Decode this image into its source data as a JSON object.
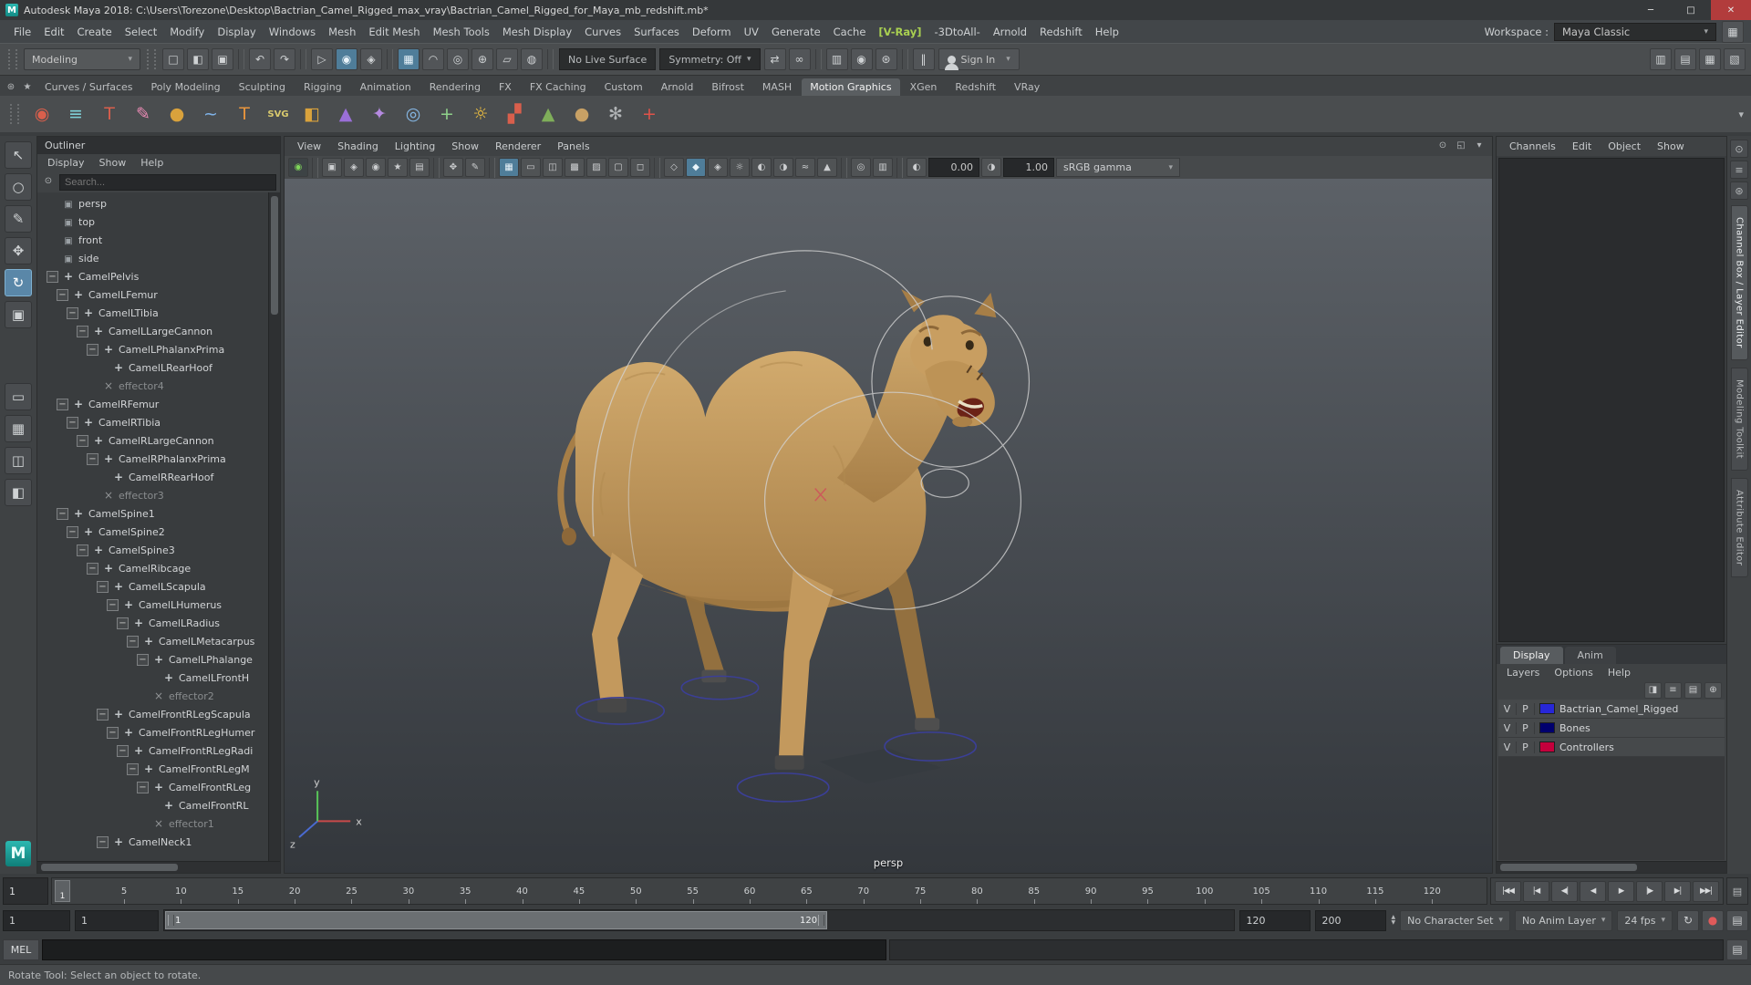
{
  "titlebar": {
    "app_initial": "M",
    "title": "Autodesk Maya 2018: C:\\Users\\Torezone\\Desktop\\Bactrian_Camel_Rigged_max_vray\\Bactrian_Camel_Rigged_for_Maya_mb_redshift.mb*",
    "buttons": {
      "minimize": "─",
      "maximize": "□",
      "close": "✕"
    }
  },
  "menubar": {
    "items": [
      {
        "label": "File"
      },
      {
        "label": "Edit"
      },
      {
        "label": "Create"
      },
      {
        "label": "Select"
      },
      {
        "label": "Modify"
      },
      {
        "label": "Display"
      },
      {
        "label": "Windows"
      },
      {
        "label": "Mesh"
      },
      {
        "label": "Edit Mesh"
      },
      {
        "label": "Mesh Tools"
      },
      {
        "label": "Mesh Display"
      },
      {
        "label": "Curves"
      },
      {
        "label": "Surfaces"
      },
      {
        "label": "Deform"
      },
      {
        "label": "UV"
      },
      {
        "label": "Generate"
      },
      {
        "label": "Cache"
      },
      {
        "label": "[V-Ray]",
        "cls": "vray"
      },
      {
        "label": "-3DtoAll-"
      },
      {
        "label": "Arnold"
      },
      {
        "label": "Redshift"
      },
      {
        "label": "Help"
      }
    ],
    "workspace_label": "Workspace :",
    "workspace_value": "Maya Classic"
  },
  "statusline": {
    "menuset": "Modeling",
    "icons1": [
      {
        "name": "new-scene-icon",
        "g": "□"
      },
      {
        "name": "open-scene-icon",
        "g": "◧"
      },
      {
        "name": "save-scene-icon",
        "g": "▣"
      },
      {
        "name": "separator",
        "cls": "sep",
        "g": ""
      },
      {
        "name": "undo-icon",
        "g": "↶"
      },
      {
        "name": "redo-icon",
        "g": "↷"
      },
      {
        "name": "separator",
        "cls": "sep",
        "g": ""
      },
      {
        "name": "select-hierarchy-icon",
        "g": "▷"
      },
      {
        "name": "select-object-icon",
        "g": "◉",
        "cls": "on"
      },
      {
        "name": "select-component-icon",
        "g": "◈"
      },
      {
        "name": "separator",
        "cls": "sep",
        "g": ""
      },
      {
        "name": "snap-to-grid-icon",
        "g": "▦",
        "cls": "on"
      },
      {
        "name": "snap-to-curve-icon",
        "g": "◠"
      },
      {
        "name": "snap-to-point-icon",
        "g": "◎"
      },
      {
        "name": "snap-to-projected-center-icon",
        "g": "⊕"
      },
      {
        "name": "snap-to-view-plane-icon",
        "g": "▱"
      },
      {
        "name": "make-object-live-icon",
        "g": "◍"
      },
      {
        "name": "separator",
        "cls": "sep",
        "g": ""
      }
    ],
    "live_surface": "No Live Surface",
    "symmetry": "Symmetry: Off",
    "icons2": [
      {
        "name": "input-connections-icon",
        "g": "⇄"
      },
      {
        "name": "construction-history-icon",
        "g": "∞"
      },
      {
        "name": "separator",
        "cls": "sep",
        "g": ""
      },
      {
        "name": "render-frame-icon",
        "g": "▥"
      },
      {
        "name": "ipr-render-icon",
        "g": "◉"
      },
      {
        "name": "render-settings-icon",
        "g": "⊛"
      },
      {
        "name": "separator",
        "cls": "sep",
        "g": ""
      },
      {
        "name": "pause-viewport-icon",
        "g": "‖"
      }
    ],
    "signin_label": "Sign In",
    "right_icons": [
      {
        "name": "sidebar-channel-box-toggle-icon",
        "g": "▥"
      },
      {
        "name": "sidebar-attribute-editor-toggle-icon",
        "g": "▤"
      },
      {
        "name": "sidebar-tool-settings-toggle-icon",
        "g": "▦"
      },
      {
        "name": "sidebar-outliner-toggle-icon",
        "g": "▧"
      }
    ]
  },
  "shelf": {
    "corner_icons": [
      {
        "name": "shelf-options-icon",
        "g": "⊛"
      },
      {
        "name": "shelf-bookmark-icon",
        "g": "★"
      }
    ],
    "tabs": [
      {
        "label": "Curves / Surfaces"
      },
      {
        "label": "Poly Modeling"
      },
      {
        "label": "Sculpting"
      },
      {
        "label": "Rigging"
      },
      {
        "label": "Animation"
      },
      {
        "label": "Rendering"
      },
      {
        "label": "FX"
      },
      {
        "label": "FX Caching"
      },
      {
        "label": "Custom"
      },
      {
        "label": "Arnold"
      },
      {
        "label": "Bifrost"
      },
      {
        "label": "MASH"
      },
      {
        "label": "Motion Graphics",
        "cls": "active"
      },
      {
        "label": "XGen"
      },
      {
        "label": "Redshift"
      },
      {
        "label": "VRay"
      }
    ],
    "items": [
      {
        "name": "mash-network-icon",
        "g": "◉",
        "c": "#d95f4c"
      },
      {
        "name": "mash-editor-icon",
        "g": "≡",
        "c": "#7fd1d8"
      },
      {
        "name": "type-tool-icon",
        "g": "T",
        "c": "#d95f4c"
      },
      {
        "name": "paint-effects-icon",
        "g": "✎",
        "c": "#e98ab4"
      },
      {
        "name": "poly-sphere-icon",
        "g": "●",
        "c": "#d9a23c"
      },
      {
        "name": "curve-tool-icon",
        "g": "~",
        "c": "#7fb2e8"
      },
      {
        "name": "three-d-type-icon",
        "g": "T",
        "c": "#e8953d"
      },
      {
        "name": "svg-tool-icon",
        "g": "SVG",
        "c": "#d8c96d",
        "cls": "small"
      },
      {
        "name": "poly-cube-icon",
        "g": "◧",
        "c": "#d9a23c"
      },
      {
        "name": "fluids-icon",
        "g": "▲",
        "c": "#9a6fd8"
      },
      {
        "name": "nparticle-icon",
        "g": "✦",
        "c": "#b58ae0"
      },
      {
        "name": "optical-fx-icon",
        "g": "◎",
        "c": "#86b8e6"
      },
      {
        "name": "motion-path-icon",
        "g": "+",
        "c": "#8fd18a"
      },
      {
        "name": "sun-light-icon",
        "g": "☼",
        "c": "#f0c040"
      },
      {
        "name": "crowd-sim-icon",
        "g": "▞",
        "c": "#d95f4c"
      },
      {
        "name": "arrow-field-icon",
        "g": "▲",
        "c": "#7fae5a"
      },
      {
        "name": "sand-sphere-icon",
        "g": "●",
        "c": "#c8a165"
      },
      {
        "name": "gear-flower-icon",
        "g": "✻",
        "c": "#b0b3b5"
      },
      {
        "name": "add-attribute-icon",
        "g": "+",
        "c": "#e0524a"
      }
    ],
    "more_glyph": "▾"
  },
  "toolbox": {
    "tools": [
      {
        "name": "select-tool",
        "g": "↖"
      },
      {
        "name": "lasso-select-tool",
        "g": "○"
      },
      {
        "name": "paint-selection-tool",
        "g": "✎"
      },
      {
        "name": "move-tool",
        "g": "✥"
      },
      {
        "name": "rotate-tool",
        "g": "↻",
        "cls": "active"
      },
      {
        "name": "scale-tool",
        "g": "▣"
      }
    ],
    "layouts": [
      {
        "name": "layout-single-pane",
        "g": "▭"
      },
      {
        "name": "layout-four-pane",
        "g": "▦"
      },
      {
        "name": "layout-two-pane",
        "g": "◫"
      },
      {
        "name": "layout-persp-outliner",
        "g": "◧"
      }
    ],
    "logo": "M"
  },
  "outliner": {
    "title": "Outliner",
    "menus": [
      "Display",
      "Show",
      "Help"
    ],
    "search_placeholder": "Search...",
    "tree": [
      {
        "label": "persp",
        "ind": 0,
        "icon": "cam"
      },
      {
        "label": "top",
        "ind": 0,
        "icon": "cam"
      },
      {
        "label": "front",
        "ind": 0,
        "icon": "cam"
      },
      {
        "label": "side",
        "ind": 0,
        "icon": "cam"
      },
      {
        "label": "CamelPelvis",
        "ind": 0,
        "icon": "joint",
        "exp": "−"
      },
      {
        "label": "CamelLFemur",
        "ind": 1,
        "icon": "joint",
        "exp": "−"
      },
      {
        "label": "CamelLTibia",
        "ind": 2,
        "icon": "joint",
        "exp": "−"
      },
      {
        "label": "CamelLLargeCannon",
        "ind": 3,
        "icon": "joint",
        "exp": "−"
      },
      {
        "label": "CamelLPhalanxPrima",
        "ind": 4,
        "icon": "joint",
        "exp": "−"
      },
      {
        "label": "CamelLRearHoof",
        "ind": 5,
        "icon": "joint"
      },
      {
        "label": "effector4",
        "ind": 4,
        "icon": "eff",
        "cls": "dim"
      },
      {
        "label": "CamelRFemur",
        "ind": 1,
        "icon": "joint",
        "exp": "−"
      },
      {
        "label": "CamelRTibia",
        "ind": 2,
        "icon": "joint",
        "exp": "−"
      },
      {
        "label": "CamelRLargeCannon",
        "ind": 3,
        "icon": "joint",
        "exp": "−"
      },
      {
        "label": "CamelRPhalanxPrima",
        "ind": 4,
        "icon": "joint",
        "exp": "−"
      },
      {
        "label": "CamelRRearHoof",
        "ind": 5,
        "icon": "joint"
      },
      {
        "label": "effector3",
        "ind": 4,
        "icon": "eff",
        "cls": "dim"
      },
      {
        "label": "CamelSpine1",
        "ind": 1,
        "icon": "joint",
        "exp": "−"
      },
      {
        "label": "CamelSpine2",
        "ind": 2,
        "icon": "joint",
        "exp": "−"
      },
      {
        "label": "CamelSpine3",
        "ind": 3,
        "icon": "joint",
        "exp": "−"
      },
      {
        "label": "CamelRibcage",
        "ind": 4,
        "icon": "joint",
        "exp": "−"
      },
      {
        "label": "CamelLScapula",
        "ind": 5,
        "icon": "joint",
        "exp": "−"
      },
      {
        "label": "CamelLHumerus",
        "ind": 6,
        "icon": "joint",
        "exp": "−"
      },
      {
        "label": "CamelLRadius",
        "ind": 7,
        "icon": "joint",
        "exp": "−"
      },
      {
        "label": "CamelLMetacarpus",
        "ind": 8,
        "icon": "joint",
        "exp": "−"
      },
      {
        "label": "CamelLPhalange",
        "ind": 9,
        "icon": "joint",
        "exp": "−"
      },
      {
        "label": "CamelLFrontH",
        "ind": 10,
        "icon": "joint"
      },
      {
        "label": "effector2",
        "ind": 9,
        "icon": "eff",
        "cls": "dim"
      },
      {
        "label": "CamelFrontRLegScapula",
        "ind": 5,
        "icon": "joint",
        "exp": "−"
      },
      {
        "label": "CamelFrontRLegHumer",
        "ind": 6,
        "icon": "joint",
        "exp": "−"
      },
      {
        "label": "CamelFrontRLegRadi",
        "ind": 7,
        "icon": "joint",
        "exp": "−"
      },
      {
        "label": "CamelFrontRLegM",
        "ind": 8,
        "icon": "joint",
        "exp": "−"
      },
      {
        "label": "CamelFrontRLeg",
        "ind": 9,
        "icon": "joint",
        "exp": "−"
      },
      {
        "label": "CamelFrontRL",
        "ind": 10,
        "icon": "joint"
      },
      {
        "label": "effector1",
        "ind": 9,
        "icon": "eff",
        "cls": "dim"
      },
      {
        "label": "CamelNeck1",
        "ind": 5,
        "icon": "joint",
        "exp": "−"
      }
    ]
  },
  "viewport": {
    "menus": [
      "View",
      "Shading",
      "Lighting",
      "Show",
      "Renderer",
      "Panels"
    ],
    "panel_icons": [
      {
        "name": "panel-pin-icon",
        "g": "⊙"
      },
      {
        "name": "panel-tearoff-icon",
        "g": "◱"
      },
      {
        "name": "panel-menu-icon",
        "g": "▾"
      }
    ],
    "toolbar_icons": [
      {
        "name": "viewport-renderer-status-icon",
        "g": "◉",
        "cls": "green"
      },
      {
        "name": "separator",
        "cls": "sep",
        "g": ""
      },
      {
        "name": "select-camera-icon",
        "g": "▣"
      },
      {
        "name": "lock-camera-icon",
        "g": "◈"
      },
      {
        "name": "camera-attributes-icon",
        "g": "◉"
      },
      {
        "name": "bookmark-view-icon",
        "g": "★"
      },
      {
        "name": "image-plane-icon",
        "g": "▤"
      },
      {
        "name": "separator",
        "cls": "sep",
        "g": ""
      },
      {
        "name": "two-d-pan-zoom-icon",
        "g": "✥"
      },
      {
        "name": "grease-pencil-icon",
        "g": "✎"
      },
      {
        "name": "separator",
        "cls": "sep",
        "g": ""
      },
      {
        "name": "grid-display-icon",
        "g": "▦",
        "cls": "on"
      },
      {
        "name": "film-gate-icon",
        "g": "▭"
      },
      {
        "name": "resolution-gate-icon",
        "g": "◫"
      },
      {
        "name": "gate-mask-icon",
        "g": "▩"
      },
      {
        "name": "field-chart-icon",
        "g": "▨"
      },
      {
        "name": "safe-action-icon",
        "g": "▢"
      },
      {
        "name": "safe-title-icon",
        "g": "◻"
      },
      {
        "name": "separator",
        "cls": "sep",
        "g": ""
      },
      {
        "name": "wireframe-mode-icon",
        "g": "◇"
      },
      {
        "name": "smooth-shade-icon",
        "g": "◆",
        "cls": "on"
      },
      {
        "name": "textured-mode-icon",
        "g": "◈"
      },
      {
        "name": "use-lights-icon",
        "g": "☼"
      },
      {
        "name": "shadows-icon",
        "g": "◐"
      },
      {
        "name": "ssao-icon",
        "g": "◑"
      },
      {
        "name": "motion-blur-icon",
        "g": "≈"
      },
      {
        "name": "anti-aliasing-icon",
        "g": "▲"
      },
      {
        "name": "separator",
        "cls": "sep",
        "g": ""
      },
      {
        "name": "isolate-select-icon",
        "g": "◎"
      },
      {
        "name": "xray-mode-icon",
        "g": "▥"
      },
      {
        "name": "separator",
        "cls": "sep",
        "g": ""
      },
      {
        "name": "exposure-icon",
        "g": "◐"
      }
    ],
    "exposure": "0.00",
    "gamma": "1.00",
    "gamma_icon": {
      "name": "gamma-icon",
      "g": "◑"
    },
    "view_transform": "sRGB gamma",
    "camera_label": "persp",
    "axis": {
      "x": "x",
      "y": "y",
      "z": "z"
    }
  },
  "rightpanel": {
    "menus": [
      "Channels",
      "Edit",
      "Object",
      "Show"
    ],
    "layer_tabs": [
      {
        "label": "Display",
        "cls": "active"
      },
      {
        "label": "Anim"
      }
    ],
    "layer_menus": [
      "Layers",
      "Options",
      "Help"
    ],
    "layer_icons": [
      {
        "name": "layer-mode-icon",
        "g": "◨"
      },
      {
        "name": "layer-sort-icon",
        "g": "≡"
      },
      {
        "name": "create-empty-layer-icon",
        "g": "▤"
      },
      {
        "name": "create-layer-from-selected-icon",
        "g": "⊕"
      }
    ],
    "layers": [
      {
        "v": "V",
        "p": "P",
        "color": "#2727d8",
        "label": "Bactrian_Camel_Rigged"
      },
      {
        "v": "V",
        "p": "P",
        "color": "#00006e",
        "label": "Bones"
      },
      {
        "v": "V",
        "p": "P",
        "color": "#c4003c",
        "label": "Controllers"
      }
    ]
  },
  "rightstrip": {
    "icons": [
      {
        "name": "strip-pin-icon",
        "g": "⊙"
      },
      {
        "name": "strip-list-icon",
        "g": "≡"
      },
      {
        "name": "strip-gear-icon",
        "g": "⊛"
      }
    ],
    "tabs": [
      {
        "label": "Channel Box / Layer Editor",
        "cls": "active"
      },
      {
        "label": "Modeling Toolkit"
      },
      {
        "label": "Attribute Editor"
      }
    ]
  },
  "timeline": {
    "current_frame": "1",
    "ticks": [
      5,
      10,
      15,
      20,
      25,
      30,
      35,
      40,
      45,
      50,
      55,
      60,
      65,
      70,
      75,
      80,
      85,
      90,
      95,
      100,
      105,
      110,
      115,
      120
    ],
    "playback": [
      {
        "name": "go-to-start-button",
        "g": "|◀◀"
      },
      {
        "name": "step-back-frame-button",
        "g": "|◀"
      },
      {
        "name": "step-back-key-button",
        "g": "◀|"
      },
      {
        "name": "play-backwards-button",
        "g": "◀"
      },
      {
        "name": "play-forwards-button",
        "g": "▶"
      },
      {
        "name": "step-forward-key-button",
        "g": "|▶"
      },
      {
        "name": "step-forward-frame-button",
        "g": "▶|"
      },
      {
        "name": "go-to-end-button",
        "g": "▶▶|"
      }
    ],
    "menu_glyph": "▤"
  },
  "range": {
    "anim_start": "1",
    "play_start": "1",
    "thumb_start_label": "1",
    "thumb_end_label": "120",
    "play_end": "120",
    "anim_end": "200",
    "character_set": "No Character Set",
    "anim_layer": "No Anim Layer",
    "fps": "24 fps",
    "icons": [
      {
        "name": "playback-loop-icon",
        "g": "↻"
      },
      {
        "name": "auto-key-icon",
        "g": "●",
        "cls": "red"
      },
      {
        "name": "animation-preferences-icon",
        "g": "▤"
      }
    ]
  },
  "cmdline": {
    "label": "MEL"
  },
  "helpline": {
    "text": "Rotate Tool: Select an object to rotate."
  }
}
